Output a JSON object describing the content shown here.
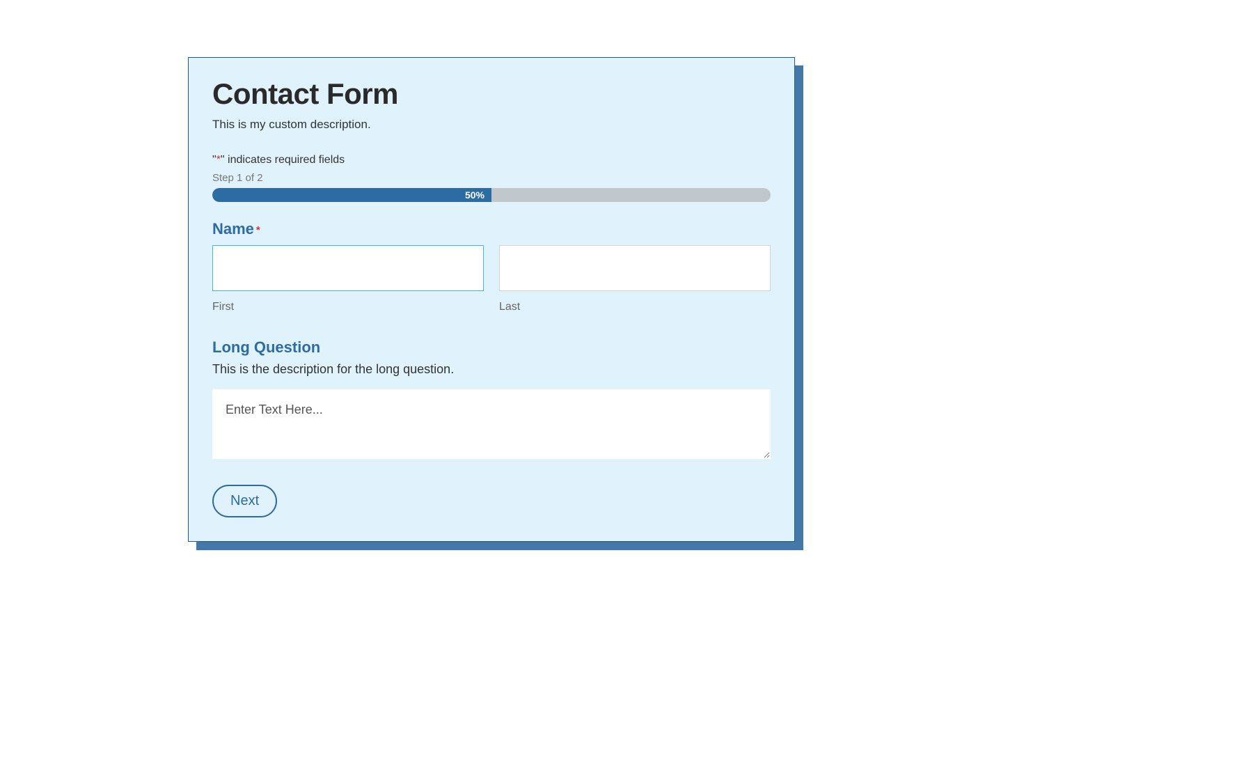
{
  "form": {
    "title": "Contact Form",
    "description": "This is my custom description.",
    "required_legend_prefix": "\"",
    "required_legend_asterisk": "*",
    "required_legend_suffix": "\" indicates required fields",
    "step_label": "Step 1 of 2",
    "progress": {
      "percent": 50,
      "label": "50%"
    },
    "fields": {
      "name": {
        "label": "Name",
        "required": true,
        "first": {
          "sublabel": "First",
          "value": ""
        },
        "last": {
          "sublabel": "Last",
          "value": ""
        }
      },
      "long_question": {
        "label": "Long Question",
        "description": "This is the description for the long question.",
        "placeholder": "Enter Text Here...",
        "value": ""
      }
    },
    "buttons": {
      "next": "Next"
    }
  },
  "colors": {
    "accent": "#2c6ca3",
    "panel_bg": "#e0f2fb",
    "shadow": "#4478a8",
    "required": "#d63638",
    "input_focus_border": "#3db5e6"
  }
}
